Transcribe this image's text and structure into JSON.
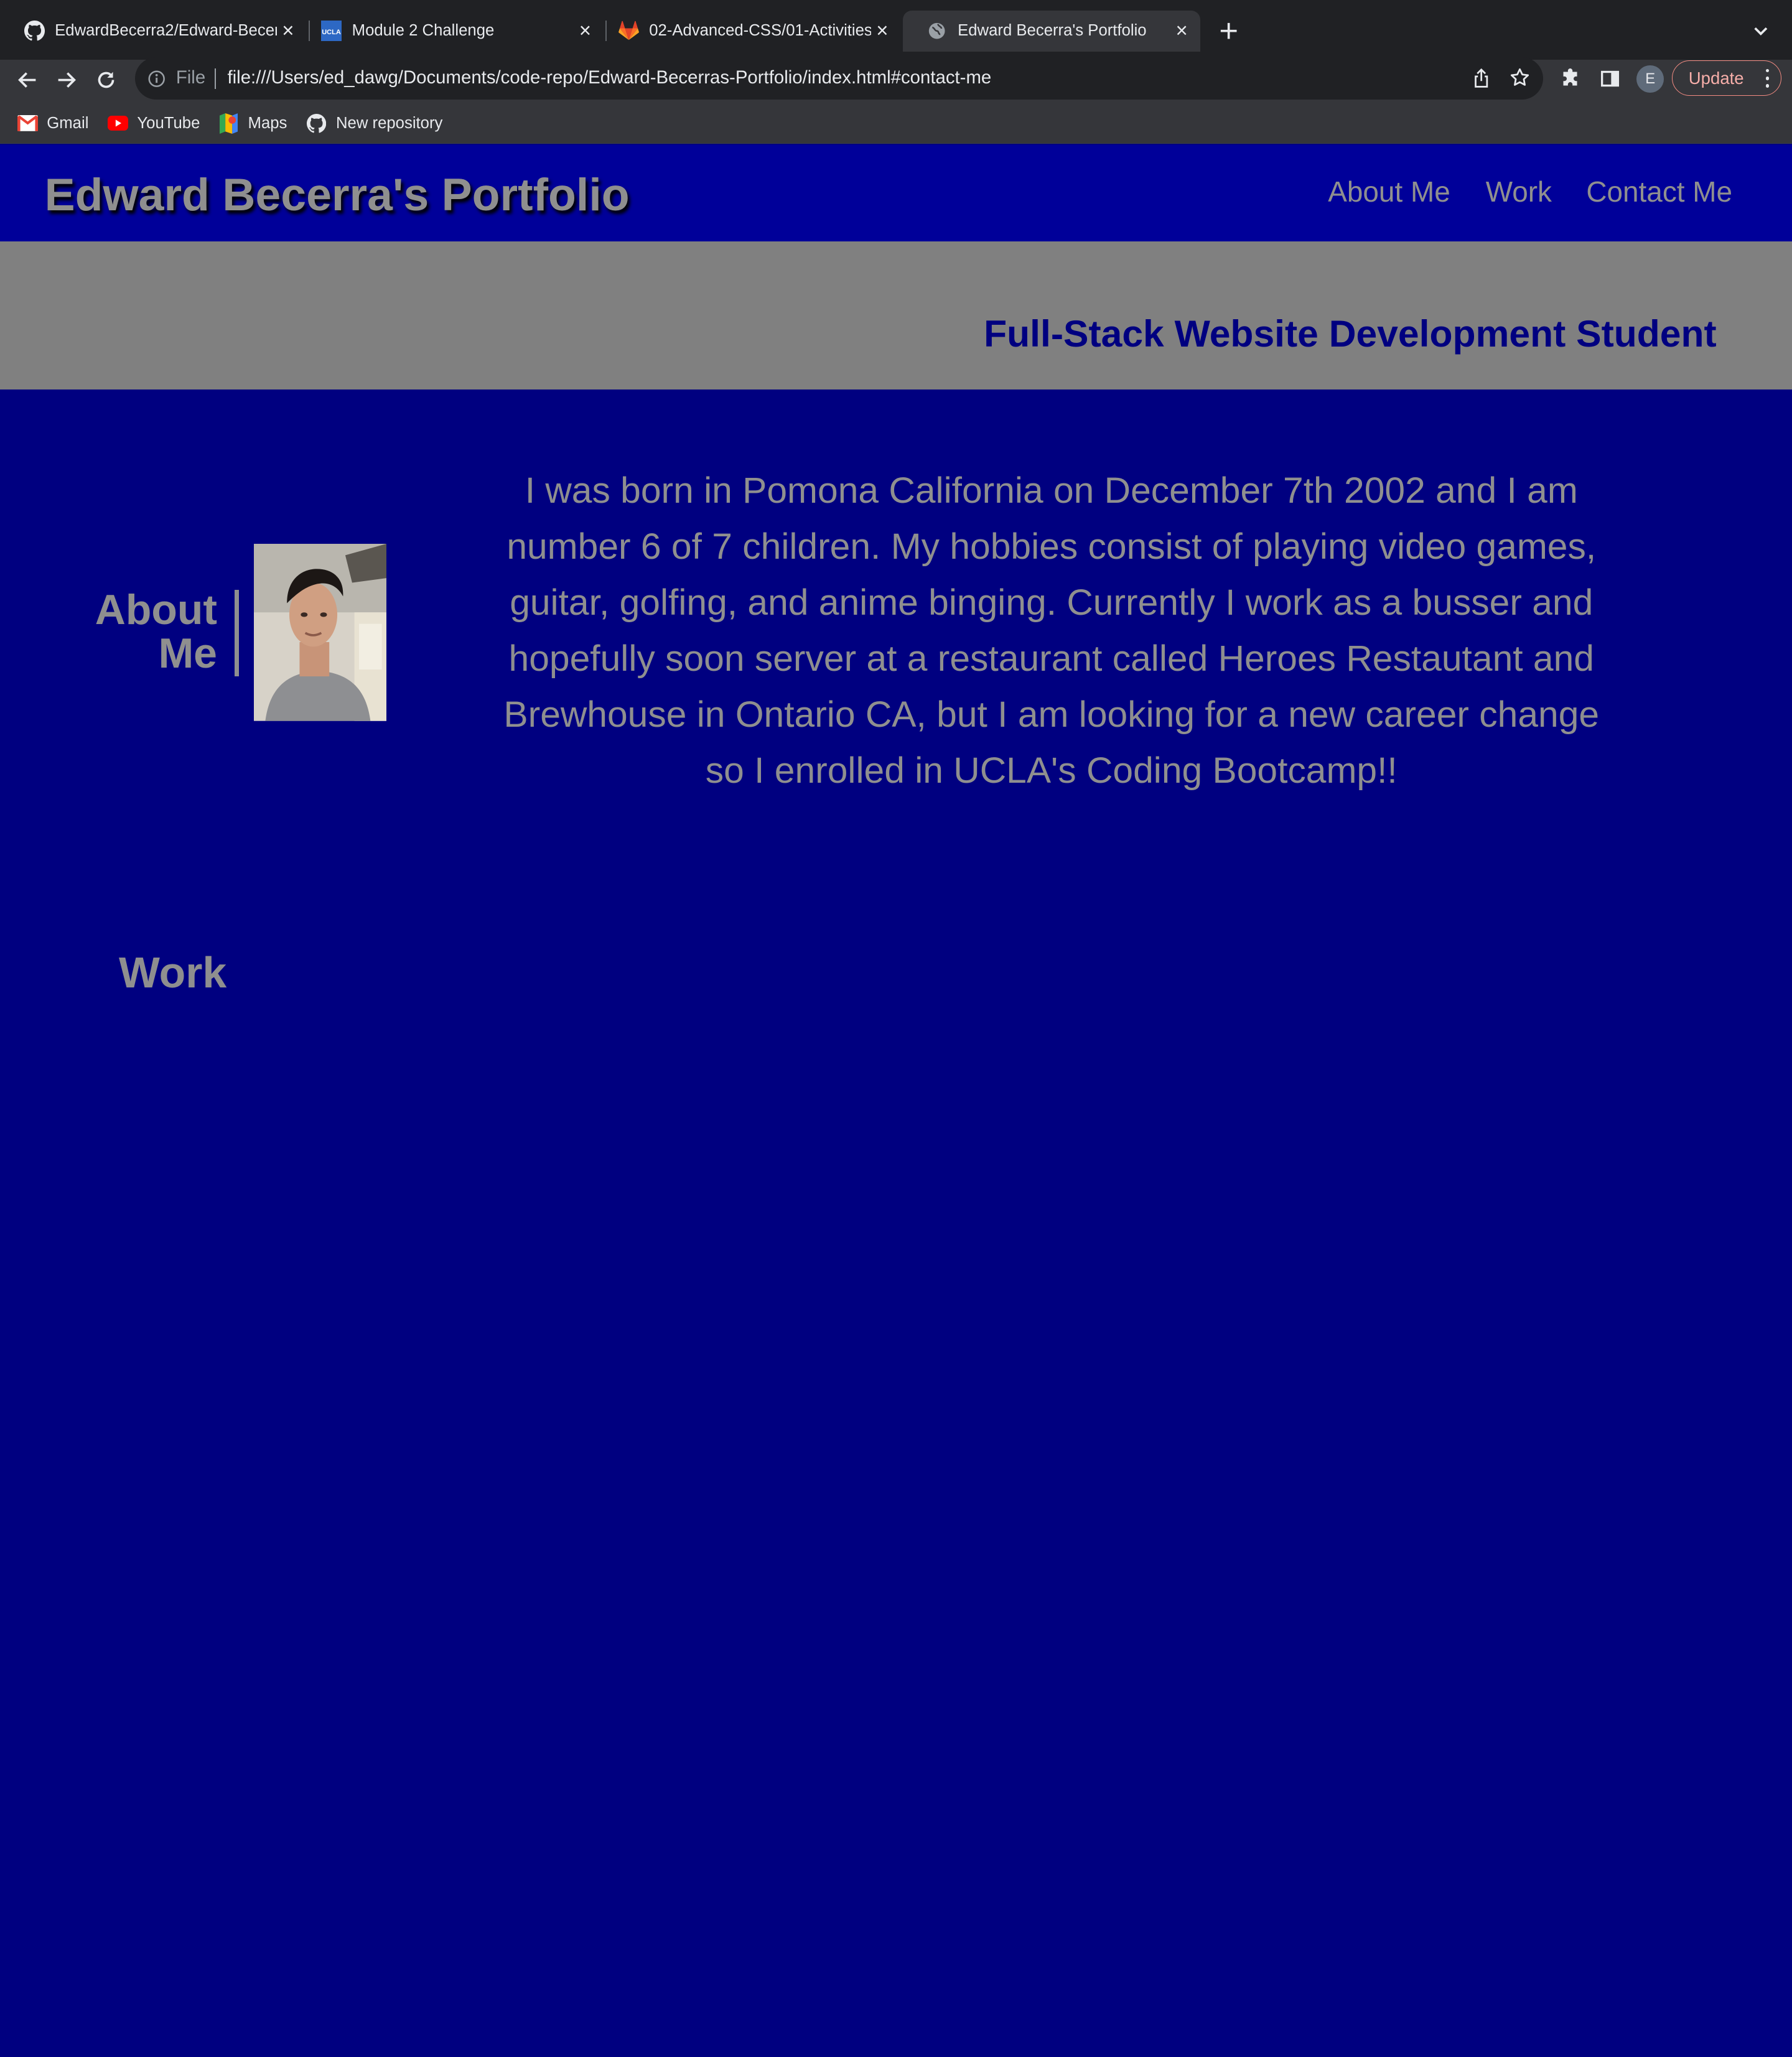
{
  "browser": {
    "tabs": [
      {
        "title": "EdwardBecerra2/Edward-Becerras-Portfolio",
        "icon": "github-icon",
        "active": false
      },
      {
        "title": "Module 2 Challenge",
        "icon": "ucla-icon",
        "active": false
      },
      {
        "title": "02-Advanced-CSS/01-Activities",
        "icon": "gitlab-icon",
        "active": false
      },
      {
        "title": "Edward Becerra's Portfolio",
        "icon": "globe-icon",
        "active": true
      }
    ],
    "omnibox": {
      "scheme_label": "File",
      "url": "file:///Users/ed_dawg/Documents/code-repo/Edward-Becerras-Portfolio/index.html#contact-me"
    },
    "profile_initial": "E",
    "update_label": "Update",
    "bookmarks": [
      {
        "label": "Gmail",
        "icon": "gmail-icon"
      },
      {
        "label": "YouTube",
        "icon": "youtube-icon"
      },
      {
        "label": "Maps",
        "icon": "maps-icon"
      },
      {
        "label": "New repository",
        "icon": "github-icon"
      }
    ]
  },
  "site": {
    "title": "Edward Becerra's Portfolio",
    "nav": [
      "About Me",
      "Work",
      "Contact Me"
    ],
    "hero_tagline": "Full-Stack Website Development Student",
    "about": {
      "heading": "About Me",
      "bio": "I was born in Pomona California on December 7th 2002 and I am number 6 of 7 children. My hobbies consist of playing video games, guitar, golfing, and anime binging. Currently I work as a busser and hopefully soon server at a restaurant called Heroes Restautant and Brewhouse in Ontario CA, but I am looking for a new career change so I enrolled in UCLA's Coding Bootcamp!!"
    },
    "work": {
      "heading": "Work"
    }
  },
  "colors": {
    "page_bg": "#000080",
    "header_bg": "#000099",
    "hero_bg": "#808080",
    "text_gray": "#8f8f8f"
  }
}
